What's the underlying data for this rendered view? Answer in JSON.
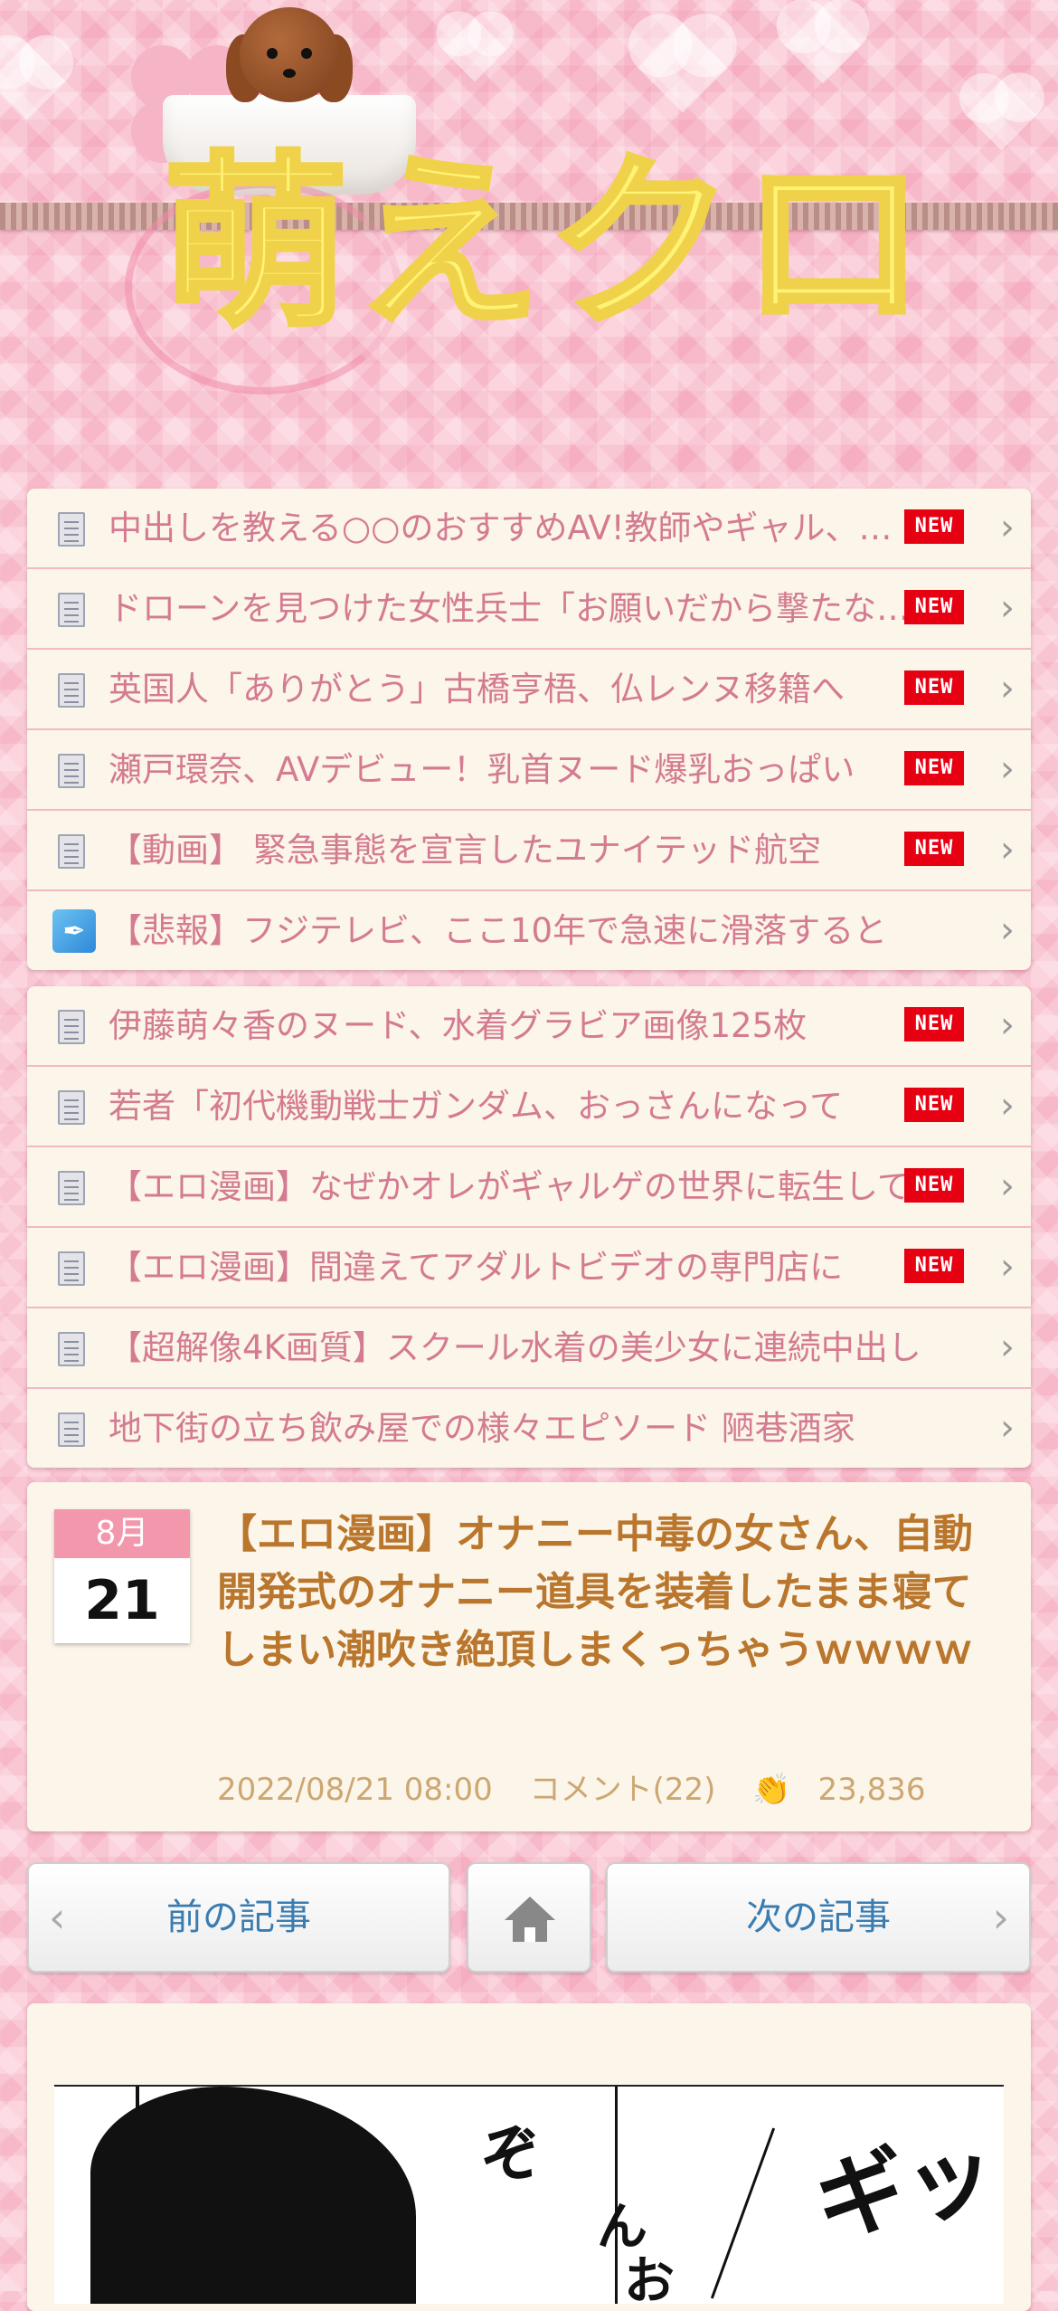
{
  "header": {
    "logo_text": "萌えクロ"
  },
  "list1": [
    {
      "icon": "document-icon",
      "label": "中出しを教える○○のおすすめAV!教師やギャル、人妻まで",
      "new": "NEW"
    },
    {
      "icon": "document-icon",
      "label": "ドローンを見つけた女性兵士「お願いだから撃たないで」",
      "new": "NEW"
    },
    {
      "icon": "document-icon",
      "label": "英国人「ありがとう」古橋亨梧、仏レンヌ移籍へ",
      "new": "NEW"
    },
    {
      "icon": "document-icon",
      "label": "瀬戸環奈、AVデビュー！乳首ヌード爆乳おっぱい",
      "new": "NEW"
    },
    {
      "icon": "document-icon",
      "label": "【動画】 緊急事態を宣言したユナイテッド航空",
      "new": "NEW"
    },
    {
      "icon": "feather-icon",
      "label": "【悲報】フジテレビ、ここ10年で急速に滑落すると",
      "new": ""
    }
  ],
  "list2": [
    {
      "icon": "document-icon",
      "label": "伊藤萌々香のヌード、水着グラビア画像125枚",
      "new": "NEW"
    },
    {
      "icon": "document-icon",
      "label": "若者「初代機動戦士ガンダム、おっさんになって",
      "new": "NEW"
    },
    {
      "icon": "document-icon",
      "label": "【エロ漫画】なぜかオレがギャルゲの世界に転生して",
      "new": "NEW"
    },
    {
      "icon": "document-icon",
      "label": "【エロ漫画】間違えてアダルトビデオの専門店に",
      "new": "NEW"
    },
    {
      "icon": "document-icon",
      "label": "【超解像4K画質】スクール水着の美少女に連続中出し",
      "new": ""
    },
    {
      "icon": "document-icon",
      "label": "地下街の立ち飲み屋での様々エピソード 陋巷酒家",
      "new": ""
    }
  ],
  "article": {
    "month": "8月",
    "day": "21",
    "title": "【エロ漫画】オナニー中毒の女さん、自動開発式のオナニー道具を装着したまま寝てしまい潮吹き絶頂しまくっちゃうｗｗｗｗ",
    "datetime": "2022/08/21 08:00",
    "comments": "コメント(22)",
    "claps": "23,836"
  },
  "nav": {
    "prev_label": "前の記事",
    "next_label": "次の記事",
    "prev_chevron": "‹",
    "next_chevron": "›"
  },
  "content": {
    "sfx1": "ギッ",
    "sfx2": "ん",
    "sfx3": "お",
    "sfx4": "ぞ"
  },
  "colors": {
    "accent_pink": "#f397ac",
    "link_text": "#d47b91",
    "title_text": "#b9762c",
    "new_badge": "#e60012",
    "nav_text": "#3a7cb0"
  }
}
